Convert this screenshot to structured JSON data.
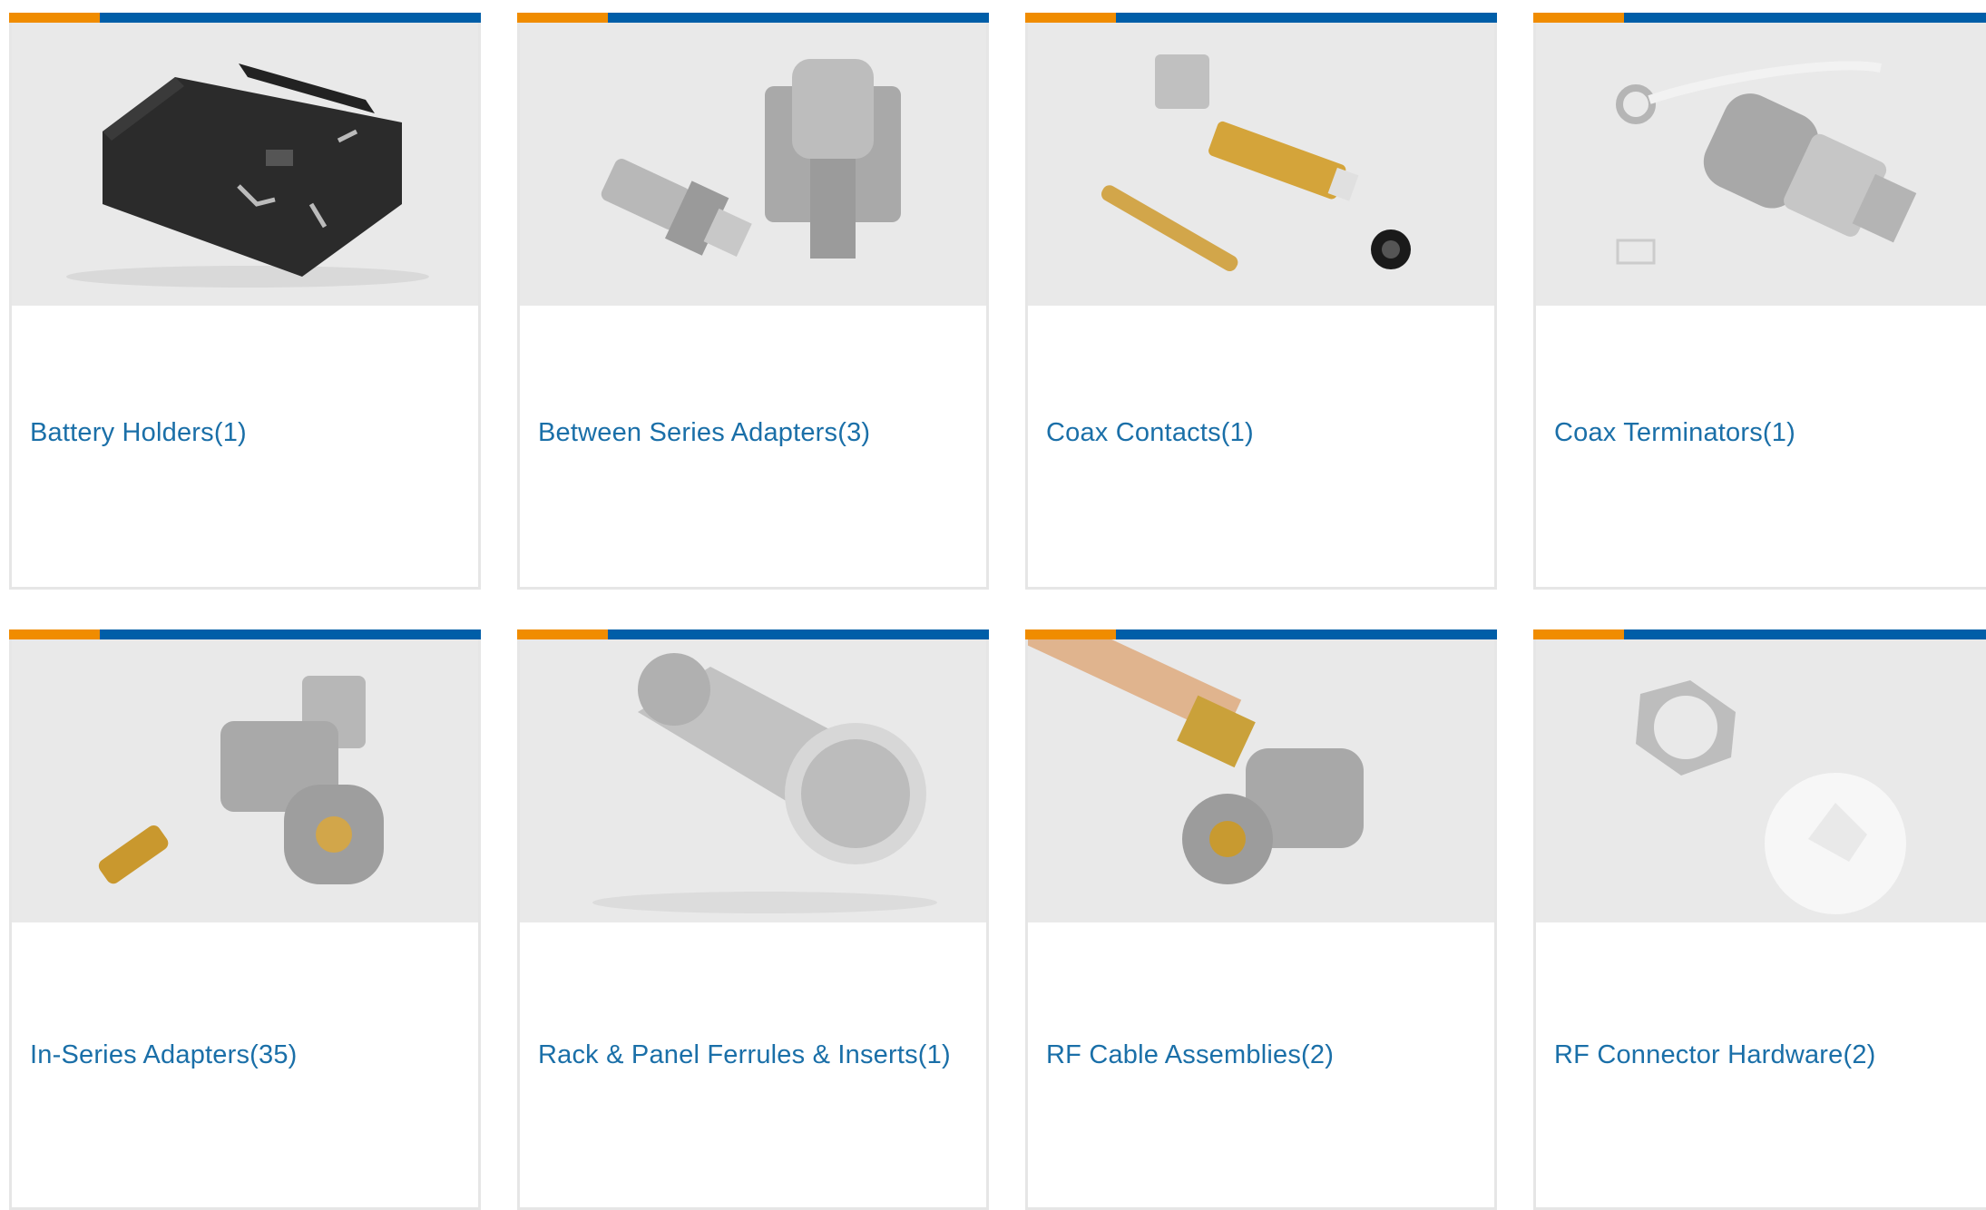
{
  "categories": [
    {
      "label": "Battery Holders(1)",
      "image_icon": "battery-holder-icon"
    },
    {
      "label": "Between Series Adapters(3)",
      "image_icon": "between-series-adapter-icon"
    },
    {
      "label": "Coax Contacts(1)",
      "image_icon": "coax-contacts-icon"
    },
    {
      "label": "Coax Terminators(1)",
      "image_icon": "coax-terminator-icon"
    },
    {
      "label": "In-Series Adapters(35)",
      "image_icon": "in-series-adapter-icon"
    },
    {
      "label": "Rack & Panel Ferrules & Inserts(1)",
      "image_icon": "ferrule-icon"
    },
    {
      "label": "RF Cable Assemblies(2)",
      "image_icon": "rf-cable-assembly-icon"
    },
    {
      "label": "RF Connector Hardware(2)",
      "image_icon": "connector-hardware-icon"
    }
  ],
  "colors": {
    "accent_orange": "#f08c00",
    "accent_blue": "#005ea8",
    "link_text": "#1a6fa8",
    "card_border": "#e6e6e6",
    "image_background": "#e9e9e9"
  }
}
